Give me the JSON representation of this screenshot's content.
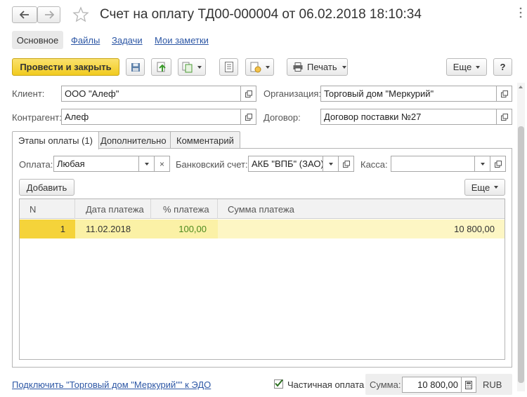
{
  "window": {
    "title": "Счет на оплату ТД00-000004 от 06.02.2018 18:10:34"
  },
  "nav_tabs": [
    {
      "label": "Основное"
    },
    {
      "label": "Файлы"
    },
    {
      "label": "Задачи"
    },
    {
      "label": "Мои заметки"
    }
  ],
  "toolbar": {
    "post_close_label": "Провести и закрыть",
    "print_label": "Печать",
    "more_label": "Еще",
    "help_label": "?"
  },
  "header_fields": {
    "client_label": "Клиент:",
    "client_value": "ООО \"Алеф\"",
    "org_label": "Организация:",
    "org_value": "Торговый дом \"Меркурий\"",
    "counterparty_label": "Контрагент:",
    "counterparty_value": "Алеф",
    "contract_label": "Договор:",
    "contract_value": "Договор поставки №27"
  },
  "inner_tabs": [
    {
      "label": "Этапы оплаты (1)"
    },
    {
      "label": "Дополнительно"
    },
    {
      "label": "Комментарий"
    }
  ],
  "payment": {
    "payment_label": "Оплата:",
    "payment_value": "Любая",
    "bank_label": "Банковский счет:",
    "bank_value": "АКБ \"ВПБ\" (ЗАО),",
    "cash_label": "Касса:",
    "cash_value": "",
    "add_label": "Добавить",
    "more_label": "Еще"
  },
  "table": {
    "headers": [
      "N",
      "Дата платежа",
      "% платежа",
      "Сумма платежа"
    ],
    "rows": [
      {
        "n": "1",
        "date": "11.02.2018",
        "percent": "100,00",
        "sum": "10 800,00"
      }
    ]
  },
  "footer": {
    "edo_link": "Подключить \"Торговый дом \"Меркурий\"\" к ЭДО",
    "partial_label": "Частичная оплата",
    "partial_checked": true,
    "sum_label": "Сумма:",
    "sum_value": "10 800,00",
    "currency": "RUB"
  },
  "colors": {
    "accent_yellow": "#f5d33a",
    "selected_row": "#fbf1a6",
    "link_blue": "#2d57a5",
    "percent_green": "#4d8a1f"
  }
}
